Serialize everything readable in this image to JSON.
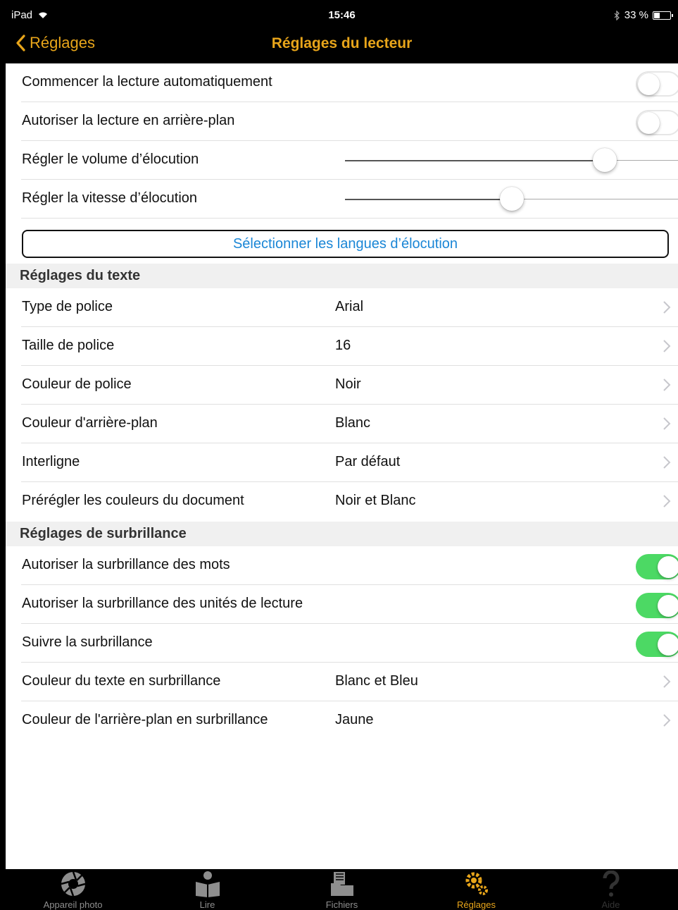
{
  "status_bar": {
    "device": "iPad",
    "time": "15:46",
    "battery": "33 %"
  },
  "nav": {
    "back_label": "Réglages",
    "title": "Réglages du lecteur"
  },
  "reading": {
    "auto_start": {
      "label": "Commencer la lecture automatiquement",
      "on": false
    },
    "background": {
      "label": "Autoriser la lecture en arrière-plan",
      "on": false
    },
    "volume": {
      "label": "Régler le volume d’élocution",
      "level": 0.78
    },
    "speed": {
      "label": "Régler la vitesse d’élocution",
      "level": 0.5
    },
    "languages_button": "Sélectionner les langues d’élocution"
  },
  "text_section": {
    "header": "Réglages du texte",
    "rows": [
      {
        "label": "Type de police",
        "value": "Arial"
      },
      {
        "label": "Taille de police",
        "value": "16"
      },
      {
        "label": "Couleur de police",
        "value": "Noir"
      },
      {
        "label": "Couleur d'arrière-plan",
        "value": "Blanc"
      },
      {
        "label": "Interligne",
        "value": "Par défaut"
      },
      {
        "label": "Prérégler les couleurs du document",
        "value": "Noir et Blanc"
      }
    ]
  },
  "highlight_section": {
    "header": "Réglages de surbrillance",
    "toggles": [
      {
        "label": "Autoriser la surbrillance des mots",
        "on": true
      },
      {
        "label": "Autoriser la surbrillance des unités de lecture",
        "on": true
      },
      {
        "label": "Suivre la surbrillance",
        "on": true
      }
    ],
    "rows": [
      {
        "label": "Couleur du texte en surbrillance",
        "value": "Blanc et Bleu"
      },
      {
        "label": "Couleur de l'arrière-plan en surbrillance",
        "value": "Jaune"
      }
    ]
  },
  "tabs": [
    {
      "label": "Appareil photo",
      "icon": "camera-aperture-icon",
      "state": "normal"
    },
    {
      "label": "Lire",
      "icon": "reader-book-icon",
      "state": "normal"
    },
    {
      "label": "Fichiers",
      "icon": "files-icon",
      "state": "normal"
    },
    {
      "label": "Réglages",
      "icon": "gears-icon",
      "state": "active"
    },
    {
      "label": "Aide",
      "icon": "help-question-icon",
      "state": "disabled"
    }
  ],
  "colors": {
    "accent": "#e8a51a",
    "link": "#1a86d6",
    "toggle_on": "#4cd964"
  }
}
